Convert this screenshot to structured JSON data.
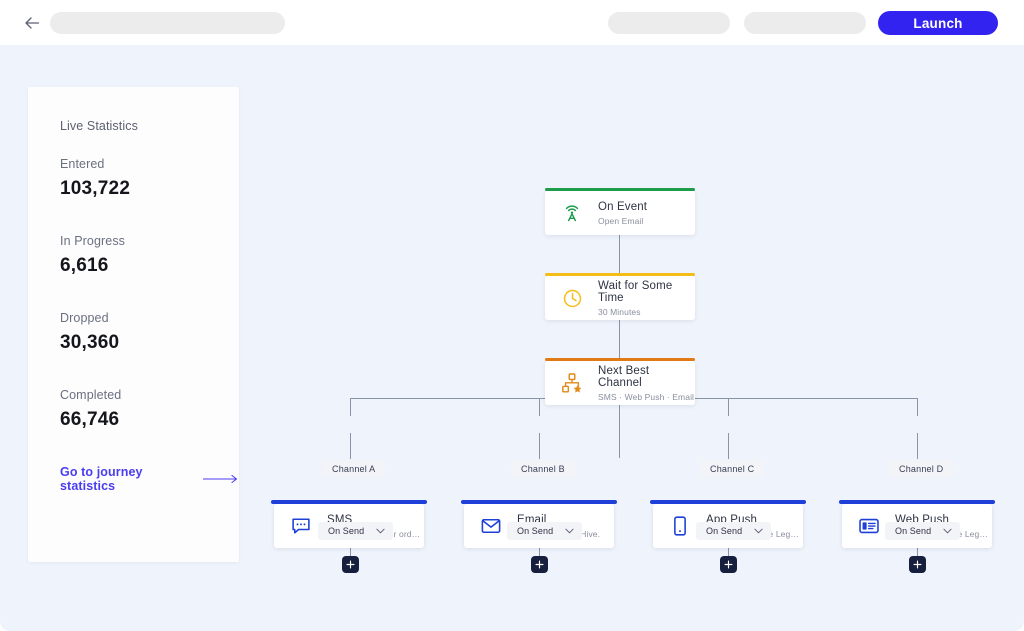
{
  "header": {
    "back_icon": "back-arrow-icon",
    "title_placeholder": "",
    "secondary_pill": "",
    "tertiary_pill": "",
    "launch_label": "Launch"
  },
  "sidebar": {
    "title": "Live Statistics",
    "stats": [
      {
        "label": "Entered",
        "value": "103,722"
      },
      {
        "label": "In Progress",
        "value": "6,616"
      },
      {
        "label": "Dropped",
        "value": "30,360"
      },
      {
        "label": "Completed",
        "value": "66,746"
      }
    ],
    "link_label": "Go to journey statistics",
    "link_icon": "long-arrow-right-icon",
    "accent_color": "#4a3df0"
  },
  "flow": {
    "trunk": [
      {
        "title": "On Event",
        "subtitle": "Open Email",
        "icon": "broadcast-tower-icon",
        "accent": "#1d9c4c"
      },
      {
        "title": "Wait for Some Time",
        "subtitle": "30 Minutes",
        "icon": "clock-icon",
        "accent": "#f5bd18"
      },
      {
        "title": "Next Best Channel",
        "subtitle": "SMS · Web Push · Email",
        "icon": "org-chart-star-icon",
        "accent": "#e07a14"
      }
    ],
    "branches": [
      {
        "chip": "Channel A",
        "title": "SMS",
        "subtitle": "Take 20% off your order with code ...",
        "icon": "chat-bubble-icon",
        "accent": "#1e3fd8",
        "trigger": "On Send",
        "add_icon": "plus-icon"
      },
      {
        "chip": "Channel B",
        "title": "Email",
        "subtitle": "Welcome to our Hive.",
        "icon": "envelope-icon",
        "accent": "#1e3fd8",
        "trigger": "On Send",
        "add_icon": "plus-icon"
      },
      {
        "chip": "Channel C",
        "title": "App Push",
        "subtitle": "Catch up with the Legends!",
        "icon": "mobile-phone-icon",
        "accent": "#1e3fd8",
        "trigger": "On Send",
        "add_icon": "plus-icon"
      },
      {
        "chip": "Channel D",
        "title": "Web Push",
        "subtitle": "Catch up with the Legends!",
        "icon": "browser-window-icon",
        "accent": "#1e3fd8",
        "trigger": "On Send",
        "add_icon": "plus-icon"
      }
    ]
  }
}
